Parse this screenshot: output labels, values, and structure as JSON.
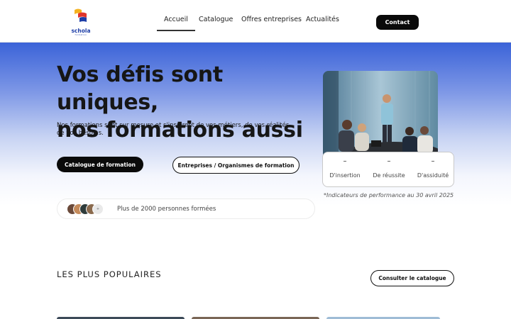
{
  "header": {
    "logo_text": "schola",
    "logo_subtext": "formation",
    "nav": [
      {
        "label": "Accueil",
        "active": true
      },
      {
        "label": "Catalogue",
        "active": false
      },
      {
        "label": "Offres entreprises",
        "active": false
      },
      {
        "label": "Actualités",
        "active": false
      }
    ],
    "contact_label": "Contact"
  },
  "hero": {
    "title_line1": "Vos défis sont uniques,",
    "title_line2": "nos formations aussi",
    "subtitle": "Nos formations sont sur mesure et s'inspirent de vos métiers, de vos réalités, de vos besoins.",
    "btn_catalogue": "Catalogue de formation",
    "btn_entreprises": "Entreprises / Organismes de formation",
    "social_proof": "Plus de 2000 personnes formées",
    "avatar_more_icon": "+"
  },
  "stats": [
    {
      "value": "–",
      "label": "D'insertion"
    },
    {
      "value": "–",
      "label": "De réussite"
    },
    {
      "value": "–",
      "label": "D'assiduité"
    }
  ],
  "footnote": "*Indicateurs de performance au 30 avril 2025",
  "popular": {
    "title": "LES PLUS POPULAIRES",
    "btn_label": "Consulter le catalogue"
  },
  "colors": {
    "brand_blue": "#1f3fa8",
    "hero_gradient_top": "#3b63d8",
    "logo_red": "#e0352b",
    "logo_yellow": "#f4b21f"
  }
}
